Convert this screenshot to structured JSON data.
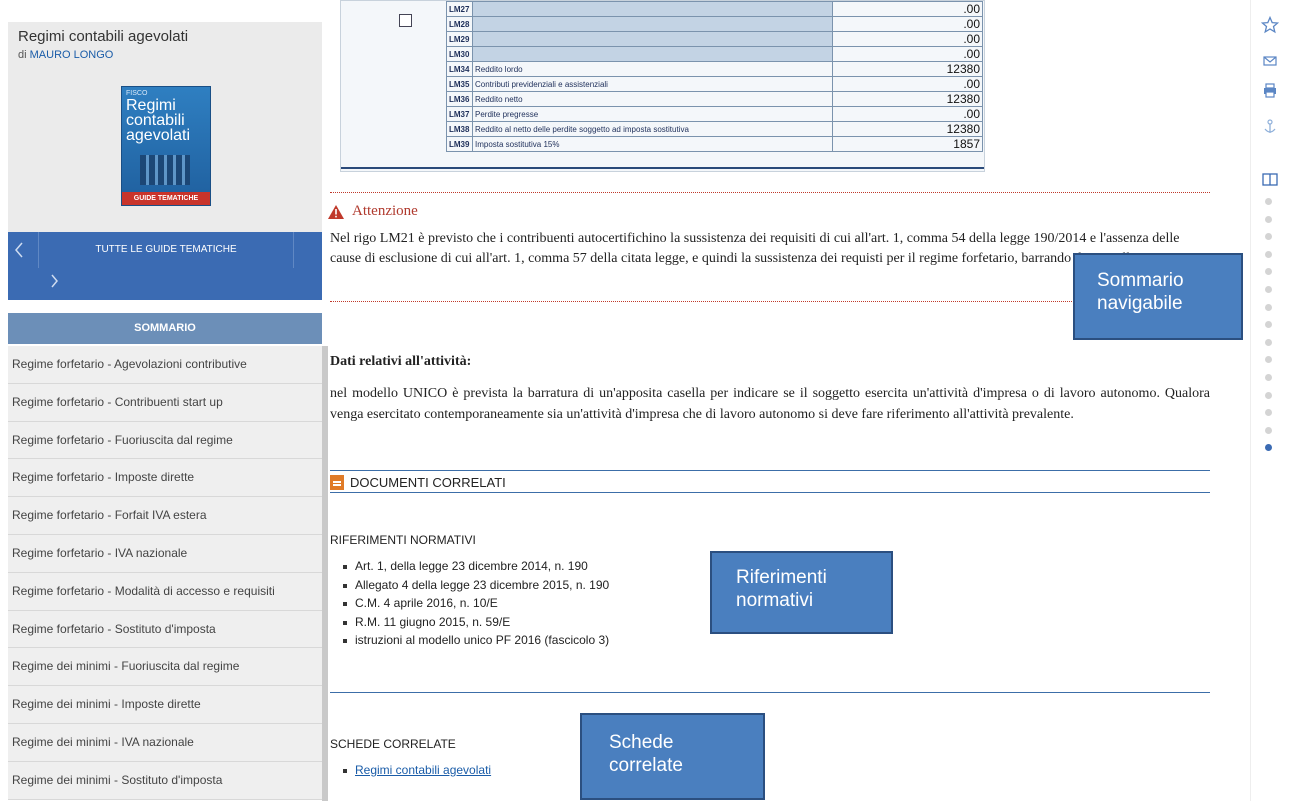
{
  "sidebar": {
    "book_title": "Regimi contabili agevolati",
    "author_prefix": "di",
    "author_name": "MAURO LONGO",
    "cover": {
      "kicker": "FISCO",
      "title_line1": "Regimi",
      "title_line2": "contabili",
      "title_line3": "agevolati",
      "band": "GUIDE TEMATICHE"
    },
    "nav_prev_icon": "chevron-left-icon",
    "nav_next_icon": "chevron-right-icon",
    "all_guides_label": "TUTTE LE GUIDE TEMATICHE",
    "summary_label": "SOMMARIO",
    "summary_items": [
      "Regime forfetario - Agevolazioni contributive",
      "Regime forfetario - Contribuenti start up",
      "Regime forfetario - Fuoriuscita dal regime",
      "Regime forfetario - Imposte dirette",
      "Regime forfetario - Forfait IVA estera",
      "Regime forfetario - IVA nazionale",
      "Regime forfetario - Modalità di accesso e requisiti",
      "Regime forfetario - Sostituto d'imposta",
      "Regime dei minimi - Fuoriuscita dal regime",
      "Regime dei minimi - Imposte dirette",
      "Regime dei minimi - IVA nazionale",
      "Regime dei minimi - Sostituto d'imposta"
    ]
  },
  "form": {
    "rows": [
      {
        "code": "LM27",
        "value": ".00"
      },
      {
        "code": "LM28",
        "value": ".00"
      },
      {
        "code": "LM29",
        "value": ".00"
      },
      {
        "code": "LM30",
        "value": ".00"
      },
      {
        "code": "LM34",
        "label": "Reddito lordo",
        "value": "12380"
      },
      {
        "code": "LM35",
        "label": "Contributi previdenziali e assistenziali",
        "value": ".00"
      },
      {
        "code": "LM36",
        "label": "Reddito netto",
        "value": "12380"
      },
      {
        "code": "LM37",
        "label": "Perdite pregresse",
        "value": ".00"
      },
      {
        "code": "LM38",
        "label": "Reddito al netto delle perdite soggetto ad imposta sostitutiva",
        "value": "12380"
      },
      {
        "code": "LM39",
        "label": "Imposta sostitutiva 15%",
        "value": "1857"
      }
    ]
  },
  "attention": {
    "title": "Attenzione",
    "text": "Nel rigo LM21 è previsto che i contribuenti autocertifichino la sussistenza dei requisiti di cui all'art. 1, comma 54 della legge 190/2014 e l'assenza delle cause di esclusione di cui all'art. 1, comma 57 della citata legge, e quindi la sussistenza dei requisti per il regime forfetario, barrando due caselle."
  },
  "activity": {
    "title": "Dati relativi all'attività:",
    "text": "nel modello UNICO è prevista la barratura di un'apposita casella per indicare se il soggetto esercita un'attività d'impresa o di lavoro autonomo. Qualora venga esercitato contemporaneamente sia un'attività d'impresa che di lavoro autonomo si deve fare riferimento all'attività prevalente."
  },
  "documents": {
    "heading": "DOCUMENTI CORRELATI",
    "refs_title": "RIFERIMENTI NORMATIVI",
    "refs": [
      "Art. 1, della legge 23 dicembre 2014, n. 190",
      "Allegato 4 della legge 23 dicembre 2015, n. 190",
      "C.M. 4 aprile 2016, n. 10/E",
      "R.M. 11 giugno 2015, n. 59/E",
      "istruzioni al modello unico PF 2016 (fascicolo 3)"
    ],
    "sched_title": "SCHEDE CORRELATE",
    "sched_link": "Regimi contabili agevolati"
  },
  "callouts": {
    "summary_line1": "Sommario",
    "summary_line2": "navigabile",
    "refs_line1": "Riferimenti",
    "refs_line2": "normativi",
    "sched_line1": "Schede",
    "sched_line2": "correlate"
  },
  "rail": {
    "icons": [
      "star-icon",
      "mail-icon",
      "print-icon",
      "anchor-icon",
      "book-icon"
    ],
    "progress_dots": 15,
    "active_dot": 15
  },
  "colors": {
    "accent_blue": "#3b6bb3",
    "warning_red": "#b03a2e",
    "doc_orange": "#e07b28"
  }
}
